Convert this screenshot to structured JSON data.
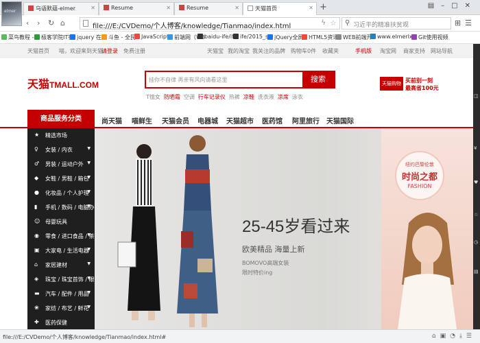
{
  "browser": {
    "tabs": [
      {
        "label": "乌语默蕴-elmer"
      },
      {
        "label": "Resume"
      },
      {
        "label": "Resume"
      },
      {
        "label": "天猫首页"
      }
    ],
    "new_tab": "+",
    "url": "file:///E:/CVDemo/个人博客/knowledge/Tianmao/index.html",
    "search_placeholder": "习近平的精准扶贫观",
    "bookmarks": [
      {
        "label": "菜鸟教程 -",
        "color": "#5cb85c"
      },
      {
        "label": "极客学院IT在",
        "color": "#2e9a3e"
      },
      {
        "label": "jquery 在线",
        "color": "#1a73e8"
      },
      {
        "label": "斗鱼 - 全民",
        "color": "#f39c12"
      },
      {
        "label": "JavaScript",
        "color": "#e74c3c"
      },
      {
        "label": "前端网（W3",
        "color": "#3498db"
      },
      {
        "label": "baidu-ife/ife",
        "color": "#333333"
      },
      {
        "label": "ife/2015_su",
        "color": "#333333"
      },
      {
        "label": "jQuery全屏",
        "color": "#1a73e8"
      },
      {
        "label": "HTML5资讯",
        "color": "#e74c3c"
      },
      {
        "label": "WEB前端开",
        "color": "#888888"
      },
      {
        "label": "www.elmerlx",
        "color": "#2980b9"
      },
      {
        "label": "Git使用视频",
        "color": "#8e44ad"
      }
    ],
    "status_url": "file:///E:/CVDemo/个人博客/knowledge/Tianmao/index.html#"
  },
  "topbar": {
    "left": [
      "天猫首页",
      "喵，欢迎来到天猫",
      "请登录",
      "免费注册"
    ],
    "right": [
      "天猫宝",
      "我的淘宝",
      "我关注的品牌",
      "购物车0件",
      "收藏夹",
      "手机版",
      "淘宝网",
      "商家支持",
      "网站导航"
    ]
  },
  "header": {
    "logo_main": "天猫",
    "logo_sub": "TMALL.COM",
    "search_placeholder": "挂你不自律 再亲有风向请看这里",
    "search_button": "搜索",
    "hot_words": [
      "T恤女",
      "防晒霜",
      "空调",
      "行车记录仪",
      "热裤",
      "凉鞋",
      "洗衣液",
      "凉席",
      "泳衣"
    ],
    "promo_box": "天猫购物券",
    "promo_line1": "买前别一刻",
    "promo_line2": "最高省100元"
  },
  "mainnav": {
    "category_header": "商品服务分类",
    "links": [
      "尚天猫",
      "喵鲜生",
      "天猫会员",
      "电器城",
      "天猫超市",
      "医药馆",
      "阿里旅行",
      "天猫国际"
    ]
  },
  "categories": [
    {
      "label": "精选市场",
      "icon": "★",
      "arrow": ""
    },
    {
      "label": "女装 / 内衣",
      "icon": "♀",
      "arrow": "▼"
    },
    {
      "label": "男装 / 运动户外",
      "icon": "♂",
      "arrow": "▼"
    },
    {
      "label": "女鞋 / 男鞋 / 箱包",
      "icon": "◆",
      "arrow": "▼"
    },
    {
      "label": "化妆品 / 个人护理",
      "icon": "●",
      "arrow": "▼"
    },
    {
      "label": "手机 / 数码 / 电脑办公",
      "icon": "▮",
      "arrow": "▼"
    },
    {
      "label": "母婴玩具",
      "icon": "☺",
      "arrow": ""
    },
    {
      "label": "零食 / 进口食品 / 茶酒",
      "icon": "◉",
      "arrow": "▼"
    },
    {
      "label": "大家电 / 生活电器",
      "icon": "▣",
      "arrow": "▼"
    },
    {
      "label": "家居建材",
      "icon": "⌂",
      "arrow": "▼"
    },
    {
      "label": "珠宝 / 珠宝首饰 / 眼镜",
      "icon": "◈",
      "arrow": "▼"
    },
    {
      "label": "汽车 / 配件 / 用品",
      "icon": "▬",
      "arrow": "▼"
    },
    {
      "label": "家纺 / 布艺 / 鲜花",
      "icon": "❀",
      "arrow": "▼"
    },
    {
      "label": "医药保健",
      "icon": "✚",
      "arrow": ""
    }
  ],
  "banner": {
    "headline": "25-45岁看过来",
    "sub": "欧美精品 海量上新",
    "brand": "BOMOVO高端女装",
    "small": "限时特价ing",
    "side_line1": "纽约巴黎伦敦",
    "side_line2": "时尚之都",
    "side_line3": "FASHION"
  },
  "rightbar_icons": [
    "cart-icon",
    "yen-icon",
    "heart-icon",
    "star-icon",
    "clock-icon",
    "file-icon"
  ]
}
